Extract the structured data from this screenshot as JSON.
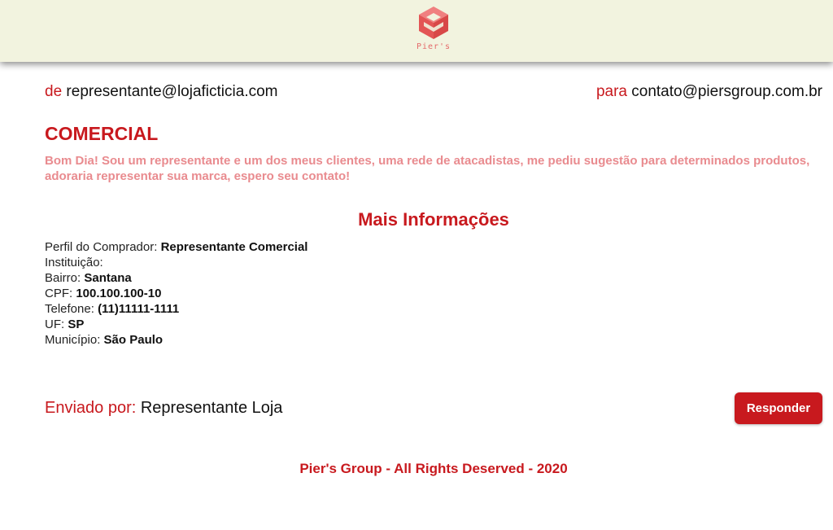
{
  "header": {
    "brand_name": "Pier's",
    "logo_icon": "cube-logo-icon",
    "background": "#f2f3df",
    "logo_color": "#e46a6a"
  },
  "email": {
    "from_prefix": "de",
    "from_address": "representante@lojaficticia.com",
    "to_prefix": "para",
    "to_address": "contato@piersgroup.com.br",
    "subject": "COMERCIAL",
    "message": "Bom Dia! Sou um representante e um dos meus clientes, uma rede de atacadistas, me pediu sugestão para determinados produtos, adoraria representar sua marca, espero seu contato!"
  },
  "more_info": {
    "title": "Mais Informações",
    "fields": [
      {
        "label": "Perfil do Comprador:",
        "value": "Representante Comercial"
      },
      {
        "label": "Instituição:",
        "value": ""
      },
      {
        "label": "Bairro:",
        "value": "Santana"
      },
      {
        "label": "CPF:",
        "value": "100.100.100-10"
      },
      {
        "label": "Telefone:",
        "value": "(11)11111-1111"
      },
      {
        "label": "UF:",
        "value": "SP"
      },
      {
        "label": "Município:",
        "value": "São Paulo"
      }
    ]
  },
  "sent_by": {
    "label": "Enviado por:",
    "name": "Representante Loja"
  },
  "actions": {
    "reply_label": "Responder"
  },
  "footer": {
    "text": "Pier's Group - All Rights Deserved - 2020"
  },
  "colors": {
    "accent": "#c8191e",
    "message_text": "#e98b8f",
    "button_text": "#ffffff"
  }
}
